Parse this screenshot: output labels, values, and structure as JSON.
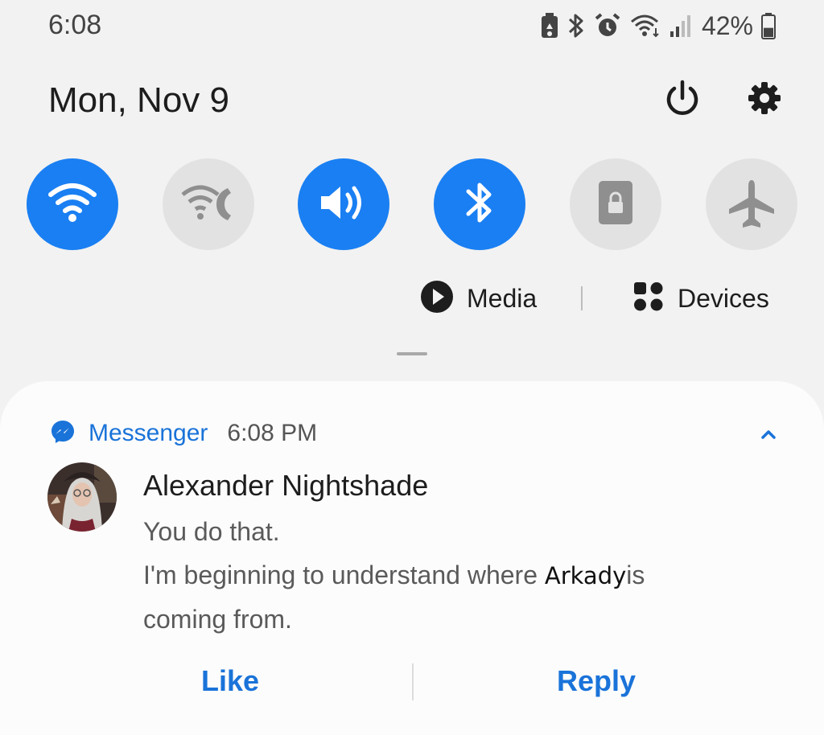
{
  "status_bar": {
    "time": "6:08",
    "battery_percent": "42%",
    "battery_level": 0.42,
    "icons": [
      "battery-saver-icon",
      "bluetooth-icon",
      "alarm-icon",
      "wifi-data-icon",
      "cell-signal-icon",
      "battery-icon"
    ]
  },
  "header": {
    "date": "Mon, Nov 9",
    "power_icon": "power-icon",
    "settings_icon": "gear-icon"
  },
  "quick_tiles": [
    {
      "icon": "wifi-icon",
      "state": "on"
    },
    {
      "icon": "wifi-calling-icon",
      "state": "off"
    },
    {
      "icon": "sound-icon",
      "state": "on"
    },
    {
      "icon": "bluetooth-icon",
      "state": "on"
    },
    {
      "icon": "rotation-lock-icon",
      "state": "off"
    },
    {
      "icon": "airplane-icon",
      "state": "off"
    }
  ],
  "media_row": {
    "media_label": "Media",
    "devices_label": "Devices"
  },
  "notification": {
    "app_name": "Messenger",
    "time": "6:08 PM",
    "sender": "Alexander Nightshade",
    "line1": "You do that.",
    "line2_before": "I'm beginning to understand where ",
    "line2_name": "Arkady",
    "line2_after": "is",
    "line3": "coming from.",
    "actions": {
      "like": "Like",
      "reply": "Reply"
    }
  },
  "colors": {
    "accent": "#1a7ff2",
    "link": "#1a73d9",
    "tile_off": "#e2e2e2",
    "background": "#f2f2f2"
  }
}
